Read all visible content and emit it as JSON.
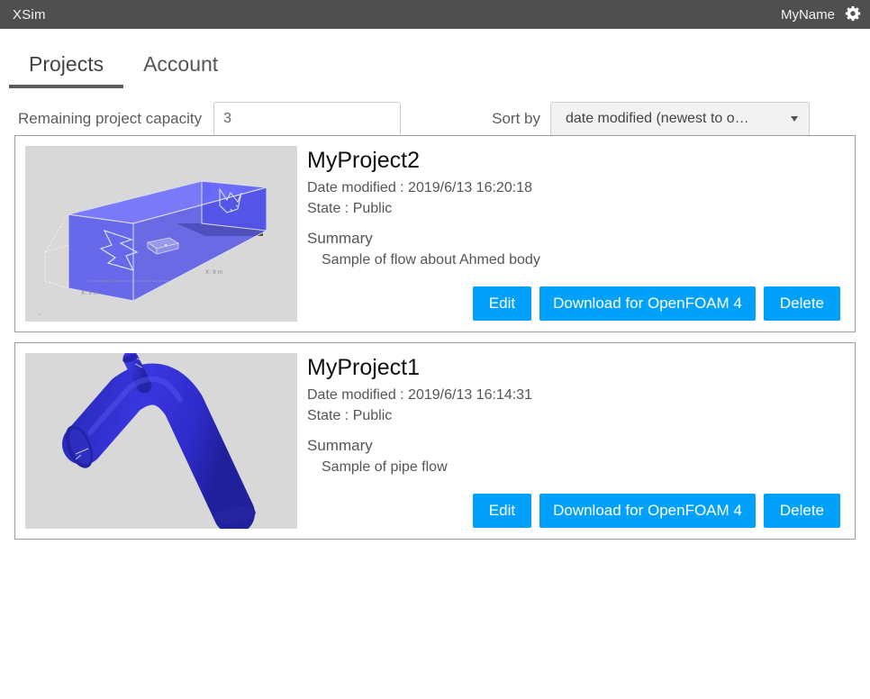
{
  "header": {
    "brand": "XSim",
    "username": "MyName",
    "gear_icon": "gear-icon",
    "bar_color": "#4f4f4f"
  },
  "tabs": [
    {
      "label": "Projects",
      "active": true
    },
    {
      "label": "Account",
      "active": false
    }
  ],
  "controls": {
    "capacity_label": "Remaining project capacity",
    "capacity_value": "3",
    "capacity_placeholder": "",
    "sort_label": "Sort by",
    "sort_value": "date modified (newest to o…",
    "sort_caret_icon": "chevron-down-icon",
    "sort_options": [
      "date modified (newest to o…"
    ]
  },
  "accent_color": "#00a0fb",
  "projects": [
    {
      "title": "MyProject2",
      "date_modified": "Date modified : 2019/6/13 16:20:18",
      "state": "State : Public",
      "summary_heading": "Summary",
      "summary_text": "Sample of flow about Ahmed body",
      "thumbnail": "ahmed-body-domain-preview",
      "buttons": {
        "edit": "Edit",
        "download": "Download for OpenFOAM 4",
        "delete": "Delete"
      }
    },
    {
      "title": "MyProject1",
      "date_modified": "Date modified : 2019/6/13 16:14:31",
      "state": "State : Public",
      "summary_heading": "Summary",
      "summary_text": "Sample of pipe flow",
      "thumbnail": "bent-pipe-preview",
      "buttons": {
        "edit": "Edit",
        "download": "Download for OpenFOAM 4",
        "delete": "Delete"
      }
    }
  ]
}
